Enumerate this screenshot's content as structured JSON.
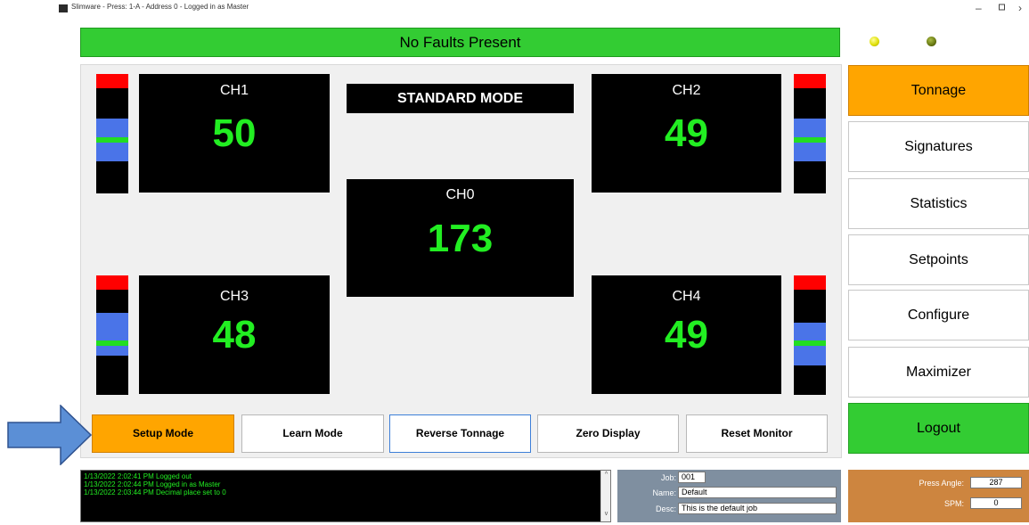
{
  "window": {
    "title": "Slimware - Press: 1-A - Address 0 - Logged in as Master",
    "minimize": "–",
    "restore": "▫",
    "close": "›"
  },
  "fault_status": "No Faults Present",
  "indicators": [
    {
      "name": "yellow-led",
      "color": "#dddd00"
    },
    {
      "name": "olive-led",
      "color": "#667711"
    }
  ],
  "mode": "STANDARD MODE",
  "channels": {
    "ch0": {
      "label": "CH0",
      "value": "173"
    },
    "ch1": {
      "label": "CH1",
      "value": "50"
    },
    "ch2": {
      "label": "CH2",
      "value": "49"
    },
    "ch3": {
      "label": "CH3",
      "value": "48"
    },
    "ch4": {
      "label": "CH4",
      "value": "49"
    }
  },
  "actions": {
    "setup_mode": "Setup Mode",
    "learn_mode": "Learn Mode",
    "reverse_tonnage": "Reverse Tonnage",
    "zero_display": "Zero Display",
    "reset_monitor": "Reset Monitor"
  },
  "nav": {
    "tonnage": "Tonnage",
    "signatures": "Signatures",
    "statistics": "Statistics",
    "setpoints": "Setpoints",
    "configure": "Configure",
    "maximizer": "Maximizer",
    "logout": "Logout"
  },
  "log": [
    "1/13/2022 2:02:41 PM  Logged out",
    "1/13/2022 2:02:44 PM  Logged in as Master",
    "1/13/2022 2:03:44 PM  Decimal place set to 0"
  ],
  "job": {
    "job_label": "Job:",
    "job_value": "001",
    "name_label": "Name:",
    "name_value": "Default",
    "desc_label": "Desc:",
    "desc_value": "This is the default job"
  },
  "press": {
    "angle_label": "Press Angle:",
    "angle_value": "287",
    "spm_label": "SPM:",
    "spm_value": "0"
  },
  "colors": {
    "fault_ok": "#33cc33",
    "active_orange": "#ffa500",
    "readout_green": "#22ee22",
    "meter_blue": "#4a74e8",
    "meter_red": "#ff0000",
    "job_panel": "#7f8fa0",
    "press_panel": "#cd853f"
  }
}
